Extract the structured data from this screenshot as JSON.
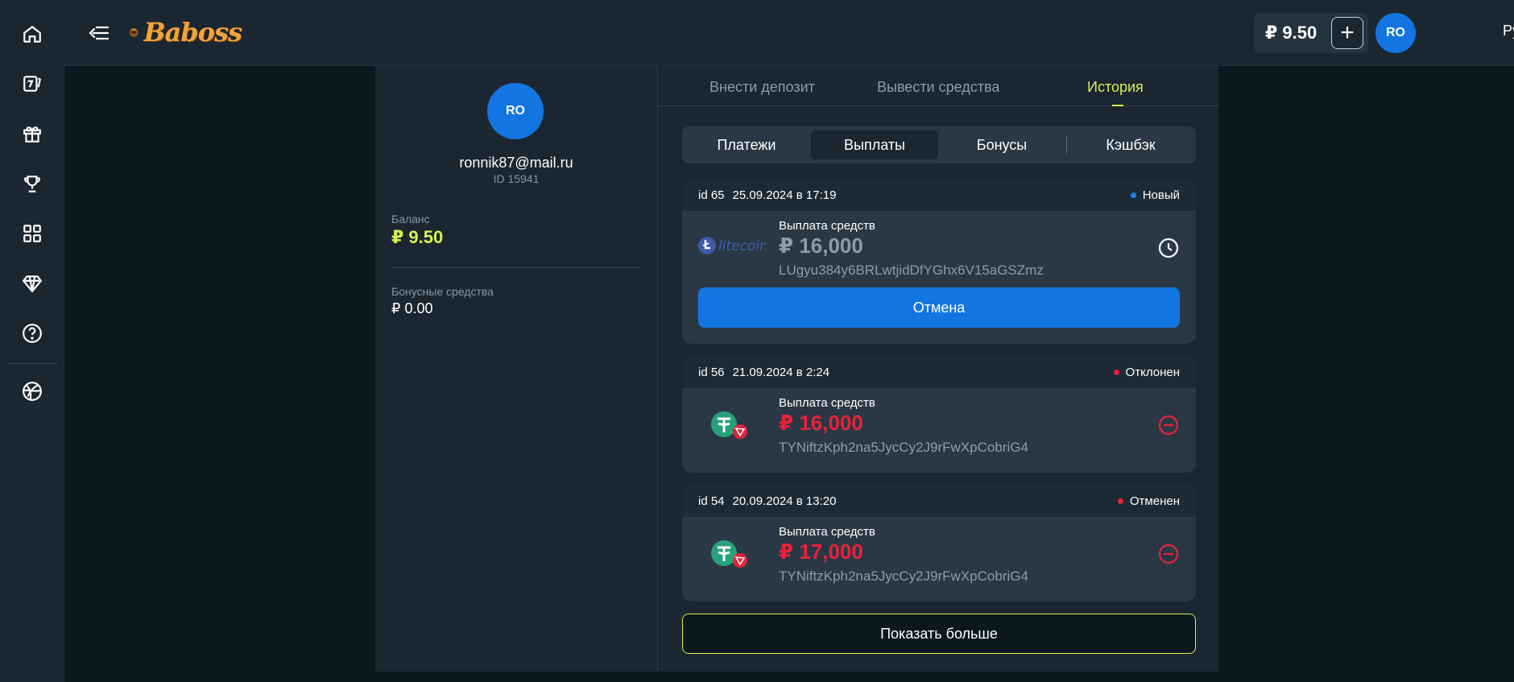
{
  "brand": {
    "logo_text": "Baboss"
  },
  "sidebar": {
    "items": [
      {
        "name": "home-icon"
      },
      {
        "name": "sports-bet-icon"
      },
      {
        "name": "gift-icon"
      },
      {
        "name": "trophy-icon"
      },
      {
        "name": "grid-icon"
      },
      {
        "name": "diamond-icon"
      },
      {
        "name": "help-icon"
      },
      {
        "name": "globe-icon"
      }
    ]
  },
  "header": {
    "balance": "₽ 9.50",
    "add_label": "+",
    "avatar": "RO",
    "language": "Рус"
  },
  "profile": {
    "avatar": "RO",
    "email": "ronnik87@mail.ru",
    "id": "ID 15941",
    "balance_label": "Баланс",
    "balance_value": "₽ 9.50",
    "bonus_label": "Бонусные средства",
    "bonus_value": "₽ 0.00"
  },
  "tabs": [
    {
      "label": "Внести депозит",
      "active": false
    },
    {
      "label": "Вывести средства",
      "active": false
    },
    {
      "label": "История",
      "active": true
    }
  ],
  "subtabs": [
    {
      "label": "Платежи",
      "active": false
    },
    {
      "label": "Выплаты",
      "active": true
    },
    {
      "label": "Бонусы",
      "active": false
    },
    {
      "label": "Кэшбэк",
      "active": false
    }
  ],
  "withdrawals": [
    {
      "id": "id 65",
      "date": "25.09.2024 в 17:19",
      "status": "Новый",
      "status_color": "#1e7fe8",
      "title": "Выплата средств",
      "amount": "₽ 16,000",
      "amount_color": "#8e9ba6",
      "address": "LUgyu384y6BRLwtjidDfYGhx6V15aGSZmz",
      "coin": "litecoin",
      "cancel_label": "Отмена"
    },
    {
      "id": "id 56",
      "date": "21.09.2024 в 2:24",
      "status": "Отклонен",
      "status_color": "#e8213b",
      "title": "Выплата средств",
      "amount": "₽ 16,000",
      "amount_color": "#e8213b",
      "address": "TYNiftzKph2na5JycCy2J9rFwXpCobriG4",
      "coin": "usdt-trc20"
    },
    {
      "id": "id 54",
      "date": "20.09.2024 в 13:20",
      "status": "Отменен",
      "status_color": "#e8213b",
      "title": "Выплата средств",
      "amount": "₽ 17,000",
      "amount_color": "#e8213b",
      "address": "TYNiftzKph2na5JycCy2J9rFwXpCobriG4",
      "coin": "usdt-trc20"
    }
  ],
  "show_more_label": "Показать больше",
  "colors": {
    "accent": "#d8f252",
    "primary": "#1375e1",
    "danger": "#e8213b"
  }
}
